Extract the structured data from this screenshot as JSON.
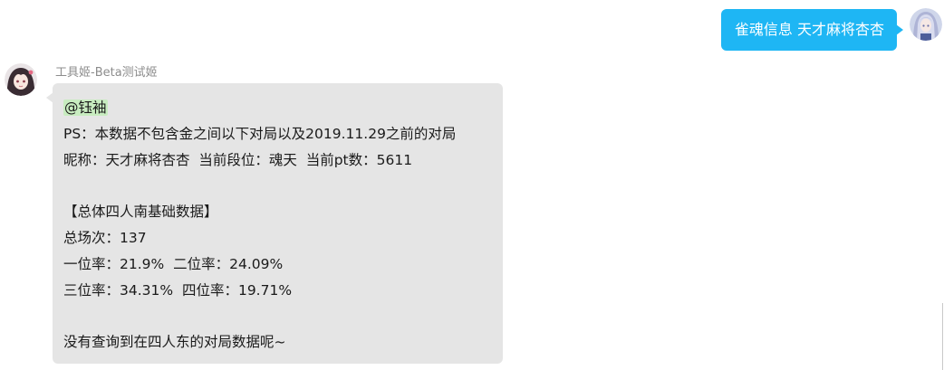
{
  "outgoing": {
    "text": "雀魂信息 天才麻将杏杏",
    "bubble_color": "#1eb6f4"
  },
  "incoming": {
    "sender": "工具姬-Beta测试姬",
    "bubble_color": "#e5e5e5",
    "mention": "@钰袖",
    "lines": [
      "PS：本数据不包含金之间以下对局以及2019.11.29之前的对局",
      "昵称：天才麻将杏杏  当前段位：魂天  当前pt数：5611",
      "",
      "【总体四人南基础数据】",
      "总场次：137",
      "一位率：21.9%  二位率：24.09%",
      "三位率：34.31%  四位率：19.71%",
      "",
      "没有查询到在四人东的对局数据呢~"
    ]
  }
}
